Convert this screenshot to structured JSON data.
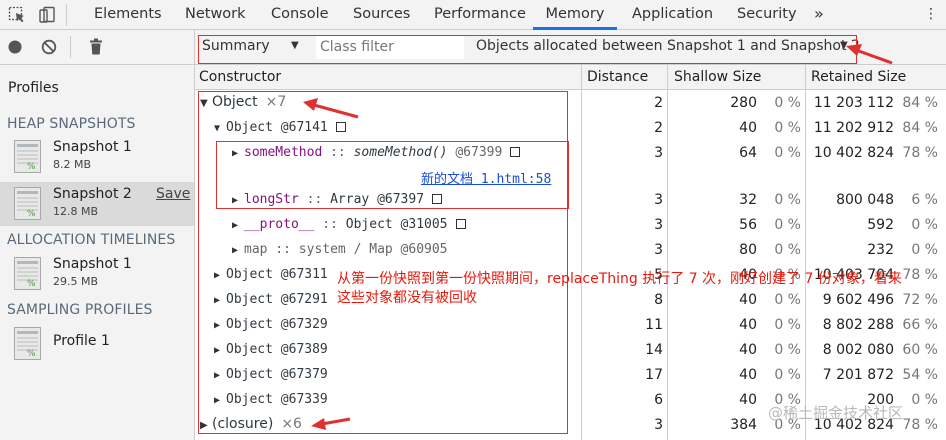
{
  "tabs": [
    {
      "label": "Elements",
      "active": false
    },
    {
      "label": "Network",
      "active": false
    },
    {
      "label": "Console",
      "active": false
    },
    {
      "label": "Sources",
      "active": false
    },
    {
      "label": "Performance",
      "active": false
    },
    {
      "label": "Memory",
      "active": true
    },
    {
      "label": "Application",
      "active": false
    },
    {
      "label": "Security",
      "active": false
    }
  ],
  "more_tabs": "»",
  "close_glyph": "⋮",
  "sidebar": {
    "title": "Profiles",
    "sections": [
      {
        "heading": "HEAP SNAPSHOTS",
        "items": [
          {
            "name": "Snapshot 1",
            "size": "8.2 MB"
          },
          {
            "name": "Snapshot 2",
            "size": "12.8 MB",
            "selected": true,
            "action": "Save"
          }
        ]
      },
      {
        "heading": "ALLOCATION TIMELINES",
        "items": [
          {
            "name": "Snapshot 1",
            "size": "29.5 MB"
          }
        ]
      },
      {
        "heading": "SAMPLING PROFILES",
        "items": [
          {
            "name": "Profile 1"
          }
        ]
      }
    ]
  },
  "toolbar": {
    "view": "Summary",
    "class_filter_placeholder": "Class filter",
    "range": "Objects allocated between Snapshot 1 and Snapshot 2"
  },
  "columns": {
    "constructor": "Constructor",
    "distance": "Distance",
    "shallow": "Shallow Size",
    "retained": "Retained Size"
  },
  "rows": [
    {
      "name": "Object",
      "count": "×7",
      "distance": "2",
      "shallow": "280",
      "shallow_pct": "0 %",
      "retained": "11 203 112",
      "retained_pct": "84 %"
    },
    {
      "name": "Object @67141",
      "distance": "2",
      "shallow": "40",
      "shallow_pct": "0 %",
      "retained": "11 202 912",
      "retained_pct": "84 %"
    },
    {
      "key": "someMethod",
      "sep": " :: ",
      "value": "someMethod()",
      "id": " @67399",
      "distance": "3",
      "shallow": "64",
      "shallow_pct": "0 %",
      "retained": "10 402 824",
      "retained_pct": "78 %"
    },
    {
      "link": "新的文档 1.html:58"
    },
    {
      "key": "longStr",
      "sep": " :: ",
      "value": "Array @67397",
      "distance": "3",
      "shallow": "32",
      "shallow_pct": "0 %",
      "retained": "800 048",
      "retained_pct": "6 %"
    },
    {
      "key": "__proto__",
      "sep": " :: ",
      "value": "Object @31005",
      "distance": "3",
      "shallow": "56",
      "shallow_pct": "0 %",
      "retained": "592",
      "retained_pct": "0 %"
    },
    {
      "key": "map",
      "sep": " :: ",
      "value": "system / Map @60905",
      "distance": "3",
      "shallow": "80",
      "shallow_pct": "0 %",
      "retained": "232",
      "retained_pct": "0 %"
    },
    {
      "name": "Object @67311",
      "distance": "5",
      "shallow": "40",
      "shallow_pct": "0 %",
      "retained": "10 403 704",
      "retained_pct": "78 %"
    },
    {
      "name": "Object @67291",
      "distance": "8",
      "shallow": "40",
      "shallow_pct": "0 %",
      "retained": "9 602 496",
      "retained_pct": "72 %"
    },
    {
      "name": "Object @67329",
      "distance": "11",
      "shallow": "40",
      "shallow_pct": "0 %",
      "retained": "8 802 288",
      "retained_pct": "66 %"
    },
    {
      "name": "Object @67389",
      "distance": "14",
      "shallow": "40",
      "shallow_pct": "0 %",
      "retained": "8 002 080",
      "retained_pct": "60 %"
    },
    {
      "name": "Object @67379",
      "distance": "17",
      "shallow": "40",
      "shallow_pct": "0 %",
      "retained": "7 201 872",
      "retained_pct": "54 %"
    },
    {
      "name": "Object @67339",
      "distance": "6",
      "shallow": "40",
      "shallow_pct": "0 %",
      "retained": "200",
      "retained_pct": "0 %"
    },
    {
      "name": "(closure)",
      "count": "×6",
      "distance": "3",
      "shallow": "384",
      "shallow_pct": "0 %",
      "retained": "10 402 824",
      "retained_pct": "78 %"
    }
  ],
  "annotation": "从第一份快照到第一份快照期间，replaceThing 执行了 7 次，刚好创建了 7 份对象，看来这些对象都没有被回收",
  "watermark": "@稀土掘金技术社区",
  "colors": {
    "accent": "#1a73e8",
    "annotation_red": "#e03131",
    "key_purple": "#881280",
    "link_blue": "#1a4ed8"
  }
}
